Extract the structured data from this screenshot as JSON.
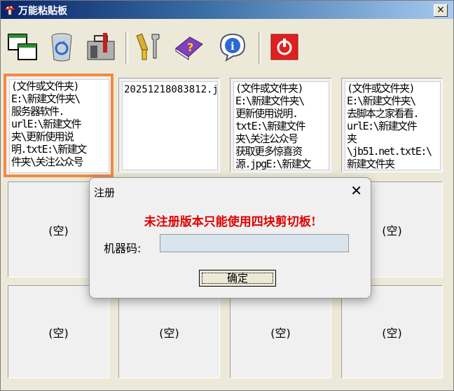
{
  "window": {
    "title": "万能粘贴板",
    "close_label": "×"
  },
  "toolbar": {
    "buttons": [
      {
        "name": "new-window-icon"
      },
      {
        "name": "recycle-bin-icon"
      },
      {
        "name": "toolbox-icon"
      },
      {
        "name": "tools-icon"
      },
      {
        "name": "help-book-icon"
      },
      {
        "name": "info-icon"
      },
      {
        "name": "exit-icon"
      }
    ]
  },
  "slots": {
    "s1": "(文件或文件夹)\nE:\\新建文件夹\\\n服务器软件.\nurlE:\\新建文件\n夹\\更新使用说\n明.txtE:\\新建文\n件夹\\关注公众号",
    "s2": "20251218083812.j",
    "s3": "(文件或文件夹)\nE:\\新建文件夹\\\n更新使用说明.\ntxtE:\\新建文件\n夹\\关注公众号\n获取更多惊喜资\n源.jpgE:\\新建文",
    "s4": "(文件或文件夹)\nE:\\新建文件夹\\\n去脚本之家看看.\nurlE:\\新建文件\n夹\n\\jb51.net.txtE:\\\n新建文件夹",
    "empty": "(空)"
  },
  "dialog": {
    "title": "注册",
    "close_label": "✕",
    "message": "未注册版本只能使用四块剪切板!",
    "machine_code_label": "机器码:",
    "machine_code_value": "",
    "ok_label": "确定"
  }
}
